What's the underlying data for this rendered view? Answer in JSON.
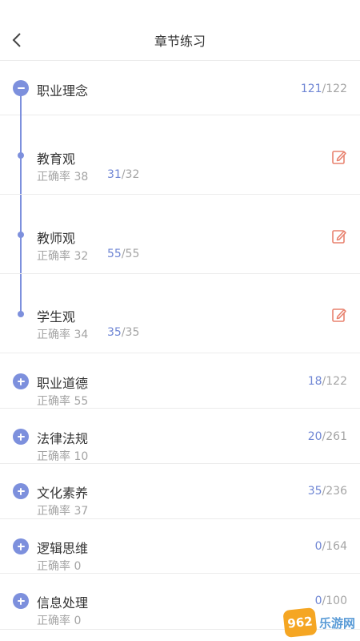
{
  "header": {
    "title": "章节练习"
  },
  "expanded": {
    "title": "职业理念",
    "done": "121",
    "total": "/122",
    "children": [
      {
        "name": "教育观",
        "accuracy": "正确率 38",
        "done": "31",
        "total": "/32"
      },
      {
        "name": "教师观",
        "accuracy": "正确率 32",
        "done": "55",
        "total": "/55"
      },
      {
        "name": "学生观",
        "accuracy": "正确率 34",
        "done": "35",
        "total": "/35"
      }
    ]
  },
  "collapsed": [
    {
      "name": "职业道德",
      "accuracy": "正确率 55",
      "done": "18",
      "total": "/122"
    },
    {
      "name": "法律法规",
      "accuracy": "正确率 10",
      "done": "20",
      "total": "/261"
    },
    {
      "name": "文化素养",
      "accuracy": "正确率 37",
      "done": "35",
      "total": "/236"
    },
    {
      "name": "逻辑思维",
      "accuracy": "正确率 0",
      "done": "0",
      "total": "/164"
    },
    {
      "name": "信息处理",
      "accuracy": "正确率 0",
      "done": "0",
      "total": "/100"
    }
  ],
  "watermark": {
    "badge": "962",
    "text": "乐游网"
  },
  "colors": {
    "accent": "#7d90dd",
    "score_highlight": "#6f86d4",
    "edit_icon": "#e8826f"
  }
}
